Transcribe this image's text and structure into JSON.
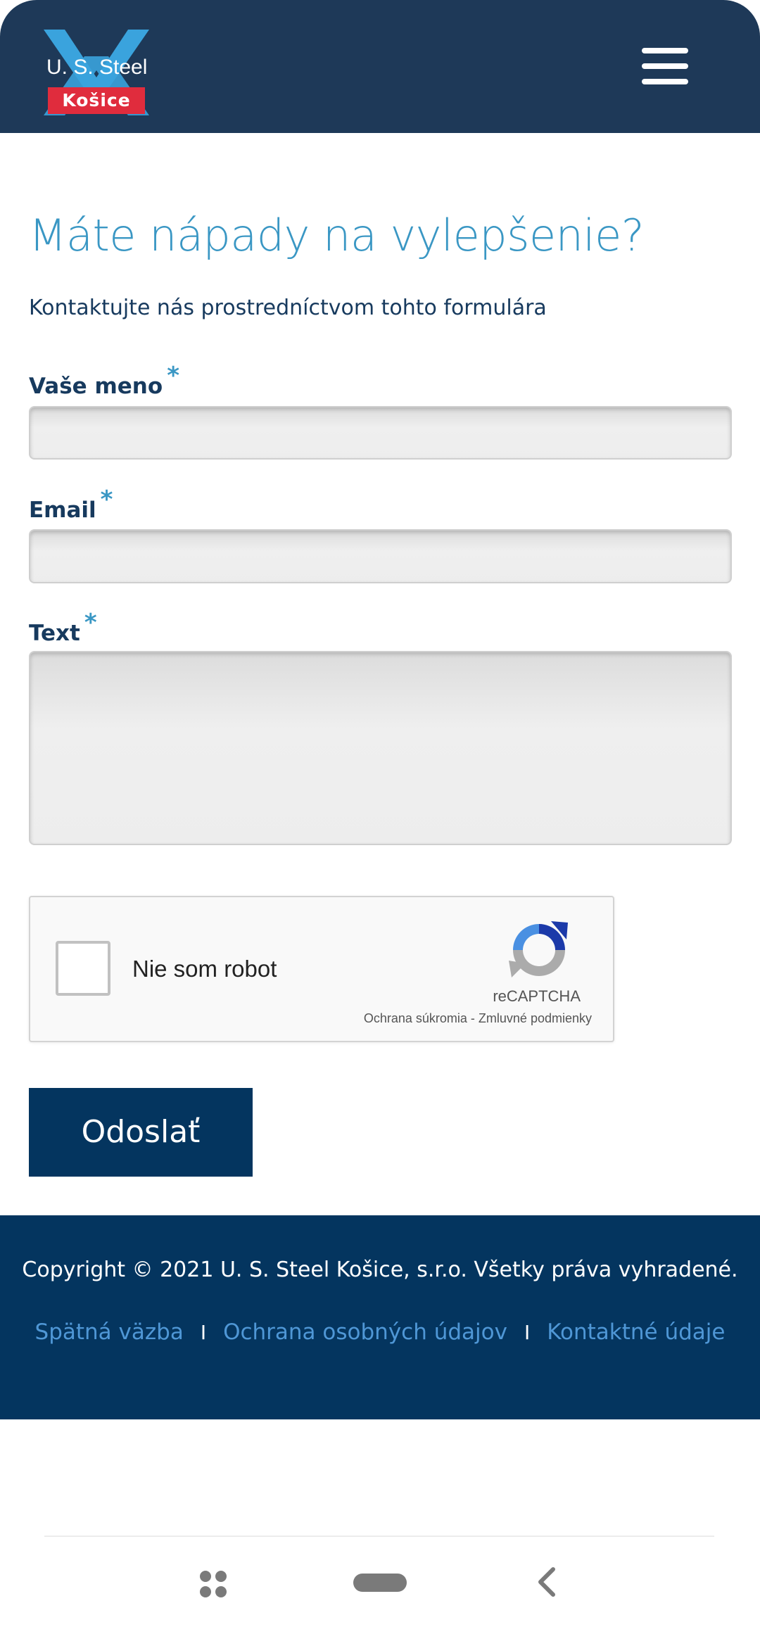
{
  "header": {
    "logo_text": "U. S. Steel",
    "logo_badge": "Košice",
    "menu_icon": "hamburger-menu-icon"
  },
  "main": {
    "title": "Máte nápady na vylepšenie?",
    "subtitle": "Kontaktujte nás prostredníctvom tohto formulára",
    "fields": {
      "name_label": "Vaše meno",
      "email_label": "Email",
      "text_label": "Text",
      "required_mark": "*"
    },
    "recaptcha": {
      "label": "Nie som robot",
      "brand": "reCAPTCHA",
      "privacy": "Ochrana súkromia",
      "separator": " - ",
      "terms": "Zmluvné podmienky"
    },
    "submit_label": "Odoslať"
  },
  "footer": {
    "copyright": "Copyright © 2021 U. S. Steel Košice, s.r.o. Všetky práva vyhradené.",
    "links": [
      "Spätná väzba",
      "Ochrana osobných údajov",
      "Kontaktné údaje"
    ],
    "separator": "I"
  },
  "colors": {
    "header_bg": "#1e3958",
    "title": "#3a97c4",
    "navy": "#04355f",
    "badge_red": "#e02c3d",
    "link_blue": "#4f97d6"
  }
}
